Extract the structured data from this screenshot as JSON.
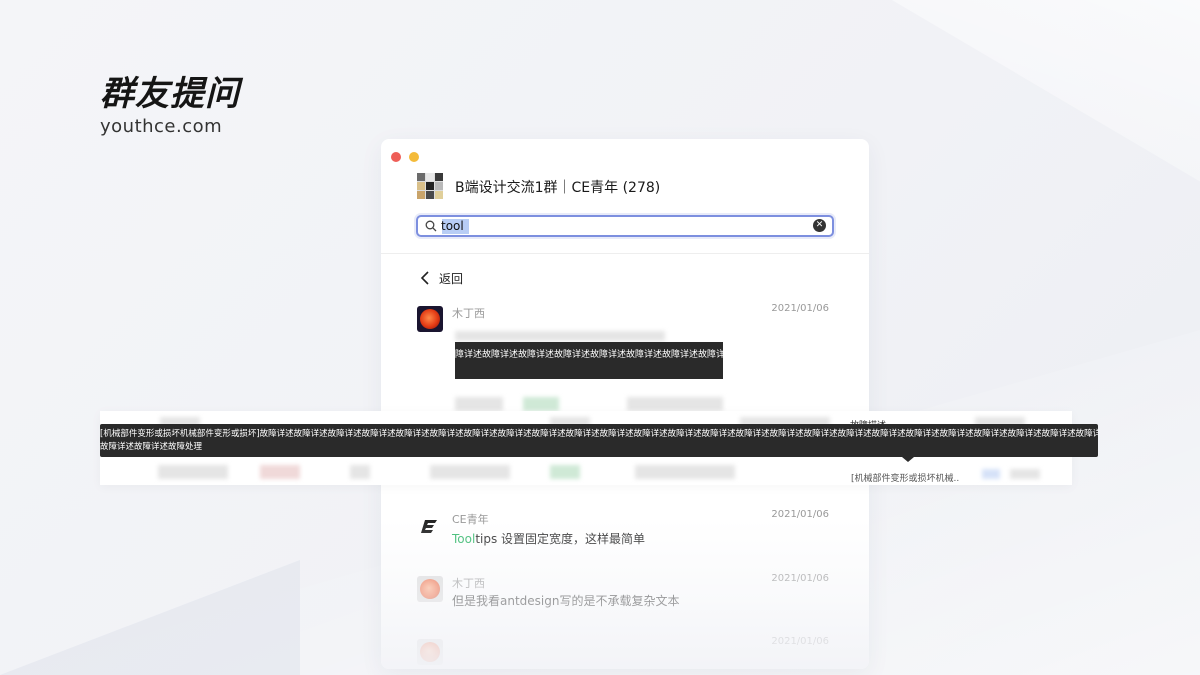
{
  "brand": {
    "title": "群友提问",
    "url": "youthce.com"
  },
  "window": {
    "group_title": "B端设计交流1群｜CE青年 (278)",
    "search": {
      "value": "tool",
      "placeholder": ""
    },
    "back_label": "返回"
  },
  "messages": [
    {
      "sender": "木丁西",
      "date": "2021/01/06",
      "tooltip_text": "障详述故障详述故障详述故障详述故障详述故障详述故障详述故障详述"
    },
    {
      "sender": "CE青年",
      "date": "2021/01/06",
      "text_keyword": "Tool",
      "text_rest": "tips 设置固定宽度，这样最简单"
    },
    {
      "sender": "木丁西",
      "date": "2021/01/06",
      "text": "但是我看antdesign写的是不承载复杂文本"
    },
    {
      "sender": "",
      "date": "2021/01/06"
    }
  ],
  "table_overlay": {
    "column_header": "故障描述",
    "tooltip_line1": "[机械部件变形或损坏机械部件变形或损坏]故障详述故障详述故障详述故障详述故障详述故障详述故障详述故障详述故障详述故障详述故障详述故障详述故障详述故障详述故障详述故障详述故障详述故障详述故障详述故障详述故障详述故障详述故障详述故障详述故障详述故障详述故障详述故障详述故障详述",
    "tooltip_line2": "故障详述故障详述故障处理",
    "truncated_cell": "[机械部件变形或损坏机械.."
  },
  "icons": {
    "search": "search-icon",
    "clear": "clear-circle-icon",
    "back": "chevron-left-icon"
  },
  "colors": {
    "keyword": "#3dbb72",
    "search_border": "#7d8fdf",
    "tooltip_bg": "#2a2a2a",
    "traffic_red": "#ee5e57",
    "traffic_yellow": "#f4bb3a"
  }
}
